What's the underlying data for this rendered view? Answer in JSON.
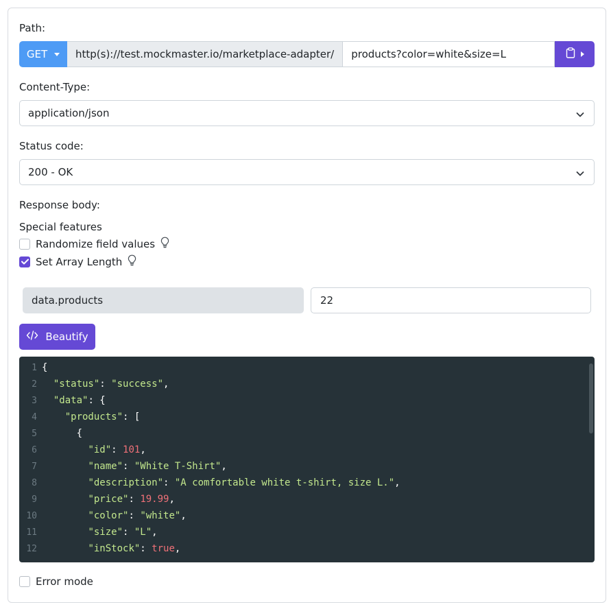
{
  "path": {
    "label": "Path:",
    "method": "GET",
    "prefix": "http(s)://test.mockmaster.io/marketplace-adapter/",
    "value": "products?color=white&size=L"
  },
  "content_type": {
    "label": "Content-Type:",
    "value": "application/json"
  },
  "status_code": {
    "label": "Status code:",
    "value": "200 - OK"
  },
  "response_body": {
    "label": "Response body:"
  },
  "special_features": {
    "label": "Special features",
    "randomize": {
      "label": "Randomize field values",
      "checked": false
    },
    "array_length": {
      "label": "Set Array Length",
      "checked": true
    }
  },
  "array_length": {
    "key": "data.products",
    "value": "22"
  },
  "beautify_label": "Beautify",
  "editor": {
    "lines": [
      {
        "n": "1",
        "indent": "",
        "parts": [
          {
            "t": "{",
            "c": "p"
          }
        ]
      },
      {
        "n": "2",
        "indent": "  ",
        "parts": [
          {
            "t": "\"status\"",
            "c": "k"
          },
          {
            "t": ": ",
            "c": "p"
          },
          {
            "t": "\"success\"",
            "c": "s"
          },
          {
            "t": ",",
            "c": "p"
          }
        ]
      },
      {
        "n": "3",
        "indent": "  ",
        "parts": [
          {
            "t": "\"data\"",
            "c": "k"
          },
          {
            "t": ": {",
            "c": "p"
          }
        ]
      },
      {
        "n": "4",
        "indent": "    ",
        "parts": [
          {
            "t": "\"products\"",
            "c": "k"
          },
          {
            "t": ": [",
            "c": "p"
          }
        ]
      },
      {
        "n": "5",
        "indent": "      ",
        "parts": [
          {
            "t": "{",
            "c": "p"
          }
        ]
      },
      {
        "n": "6",
        "indent": "        ",
        "parts": [
          {
            "t": "\"id\"",
            "c": "k"
          },
          {
            "t": ": ",
            "c": "p"
          },
          {
            "t": "101",
            "c": "n"
          },
          {
            "t": ",",
            "c": "p"
          }
        ]
      },
      {
        "n": "7",
        "indent": "        ",
        "parts": [
          {
            "t": "\"name\"",
            "c": "k"
          },
          {
            "t": ": ",
            "c": "p"
          },
          {
            "t": "\"White T-Shirt\"",
            "c": "s"
          },
          {
            "t": ",",
            "c": "p"
          }
        ]
      },
      {
        "n": "8",
        "indent": "        ",
        "parts": [
          {
            "t": "\"description\"",
            "c": "k"
          },
          {
            "t": ": ",
            "c": "p"
          },
          {
            "t": "\"A comfortable white t-shirt, size L.\"",
            "c": "s"
          },
          {
            "t": ",",
            "c": "p"
          }
        ]
      },
      {
        "n": "9",
        "indent": "        ",
        "parts": [
          {
            "t": "\"price\"",
            "c": "k"
          },
          {
            "t": ": ",
            "c": "p"
          },
          {
            "t": "19.99",
            "c": "n"
          },
          {
            "t": ",",
            "c": "p"
          }
        ]
      },
      {
        "n": "10",
        "indent": "        ",
        "parts": [
          {
            "t": "\"color\"",
            "c": "k"
          },
          {
            "t": ": ",
            "c": "p"
          },
          {
            "t": "\"white\"",
            "c": "s"
          },
          {
            "t": ",",
            "c": "p"
          }
        ]
      },
      {
        "n": "11",
        "indent": "        ",
        "parts": [
          {
            "t": "\"size\"",
            "c": "k"
          },
          {
            "t": ": ",
            "c": "p"
          },
          {
            "t": "\"L\"",
            "c": "s"
          },
          {
            "t": ",",
            "c": "p"
          }
        ]
      },
      {
        "n": "12",
        "indent": "        ",
        "parts": [
          {
            "t": "\"inStock\"",
            "c": "k"
          },
          {
            "t": ": ",
            "c": "p"
          },
          {
            "t": "true",
            "c": "b"
          },
          {
            "t": ",",
            "c": "p"
          }
        ]
      }
    ]
  },
  "error_mode": {
    "label": "Error mode",
    "checked": false
  },
  "colors": {
    "primary": "#6549d5",
    "method": "#4e9bf5",
    "editor_bg": "#263238",
    "json_key": "#c3e88d",
    "json_number": "#f07178"
  },
  "icons": {
    "method_dropdown": "caret-down-icon",
    "clipboard": "clipboard-icon",
    "select_chevron": "chevron-down-icon",
    "hint": "lightbulb-icon",
    "check": "check-icon",
    "code": "code-icon"
  }
}
